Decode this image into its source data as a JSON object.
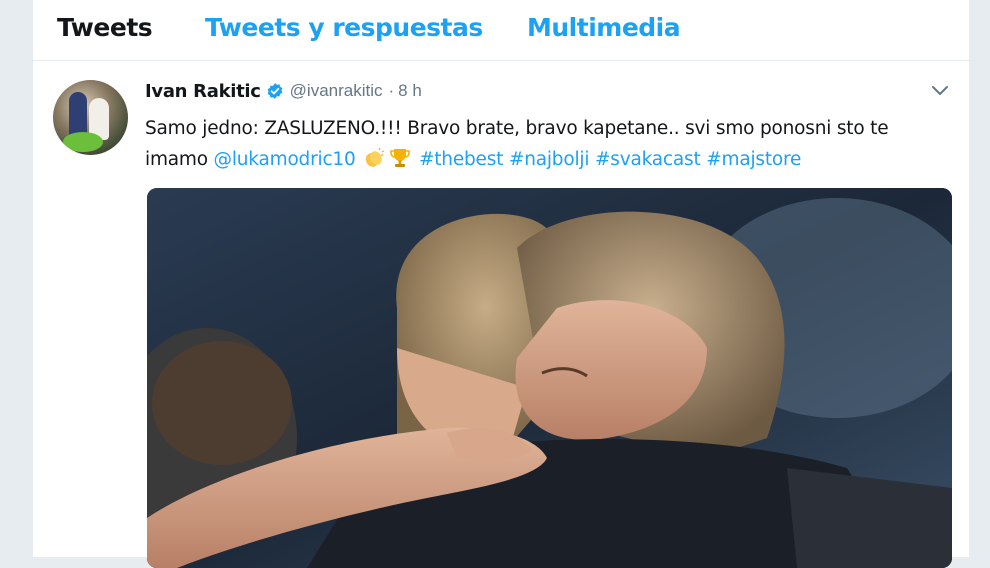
{
  "tabs": [
    {
      "label": "Tweets",
      "active": true
    },
    {
      "label": "Tweets y respuestas",
      "active": false
    },
    {
      "label": "Multimedia",
      "active": false
    }
  ],
  "tweet": {
    "author_name": "Ivan Rakitic",
    "verified": true,
    "handle": "@ivanrakitic",
    "separator": "·",
    "time": "8 h",
    "text_plain_1": "Samo jedno: ZASLUZENO.!!! Bravo brate, bravo kapetane.. svi smo ponosni sto te imamo ",
    "mention": "@lukamodric10",
    "emojis": [
      "clapping-hands",
      "trophy"
    ],
    "hashtags": [
      "#thebest",
      "#najbolji",
      "#svakacast",
      "#majstore"
    ],
    "media_alt": "photo-two-players-embracing"
  },
  "colors": {
    "accent": "#1da1f2",
    "text": "#14171a",
    "muted": "#657786",
    "background": "#e6ecf0"
  }
}
